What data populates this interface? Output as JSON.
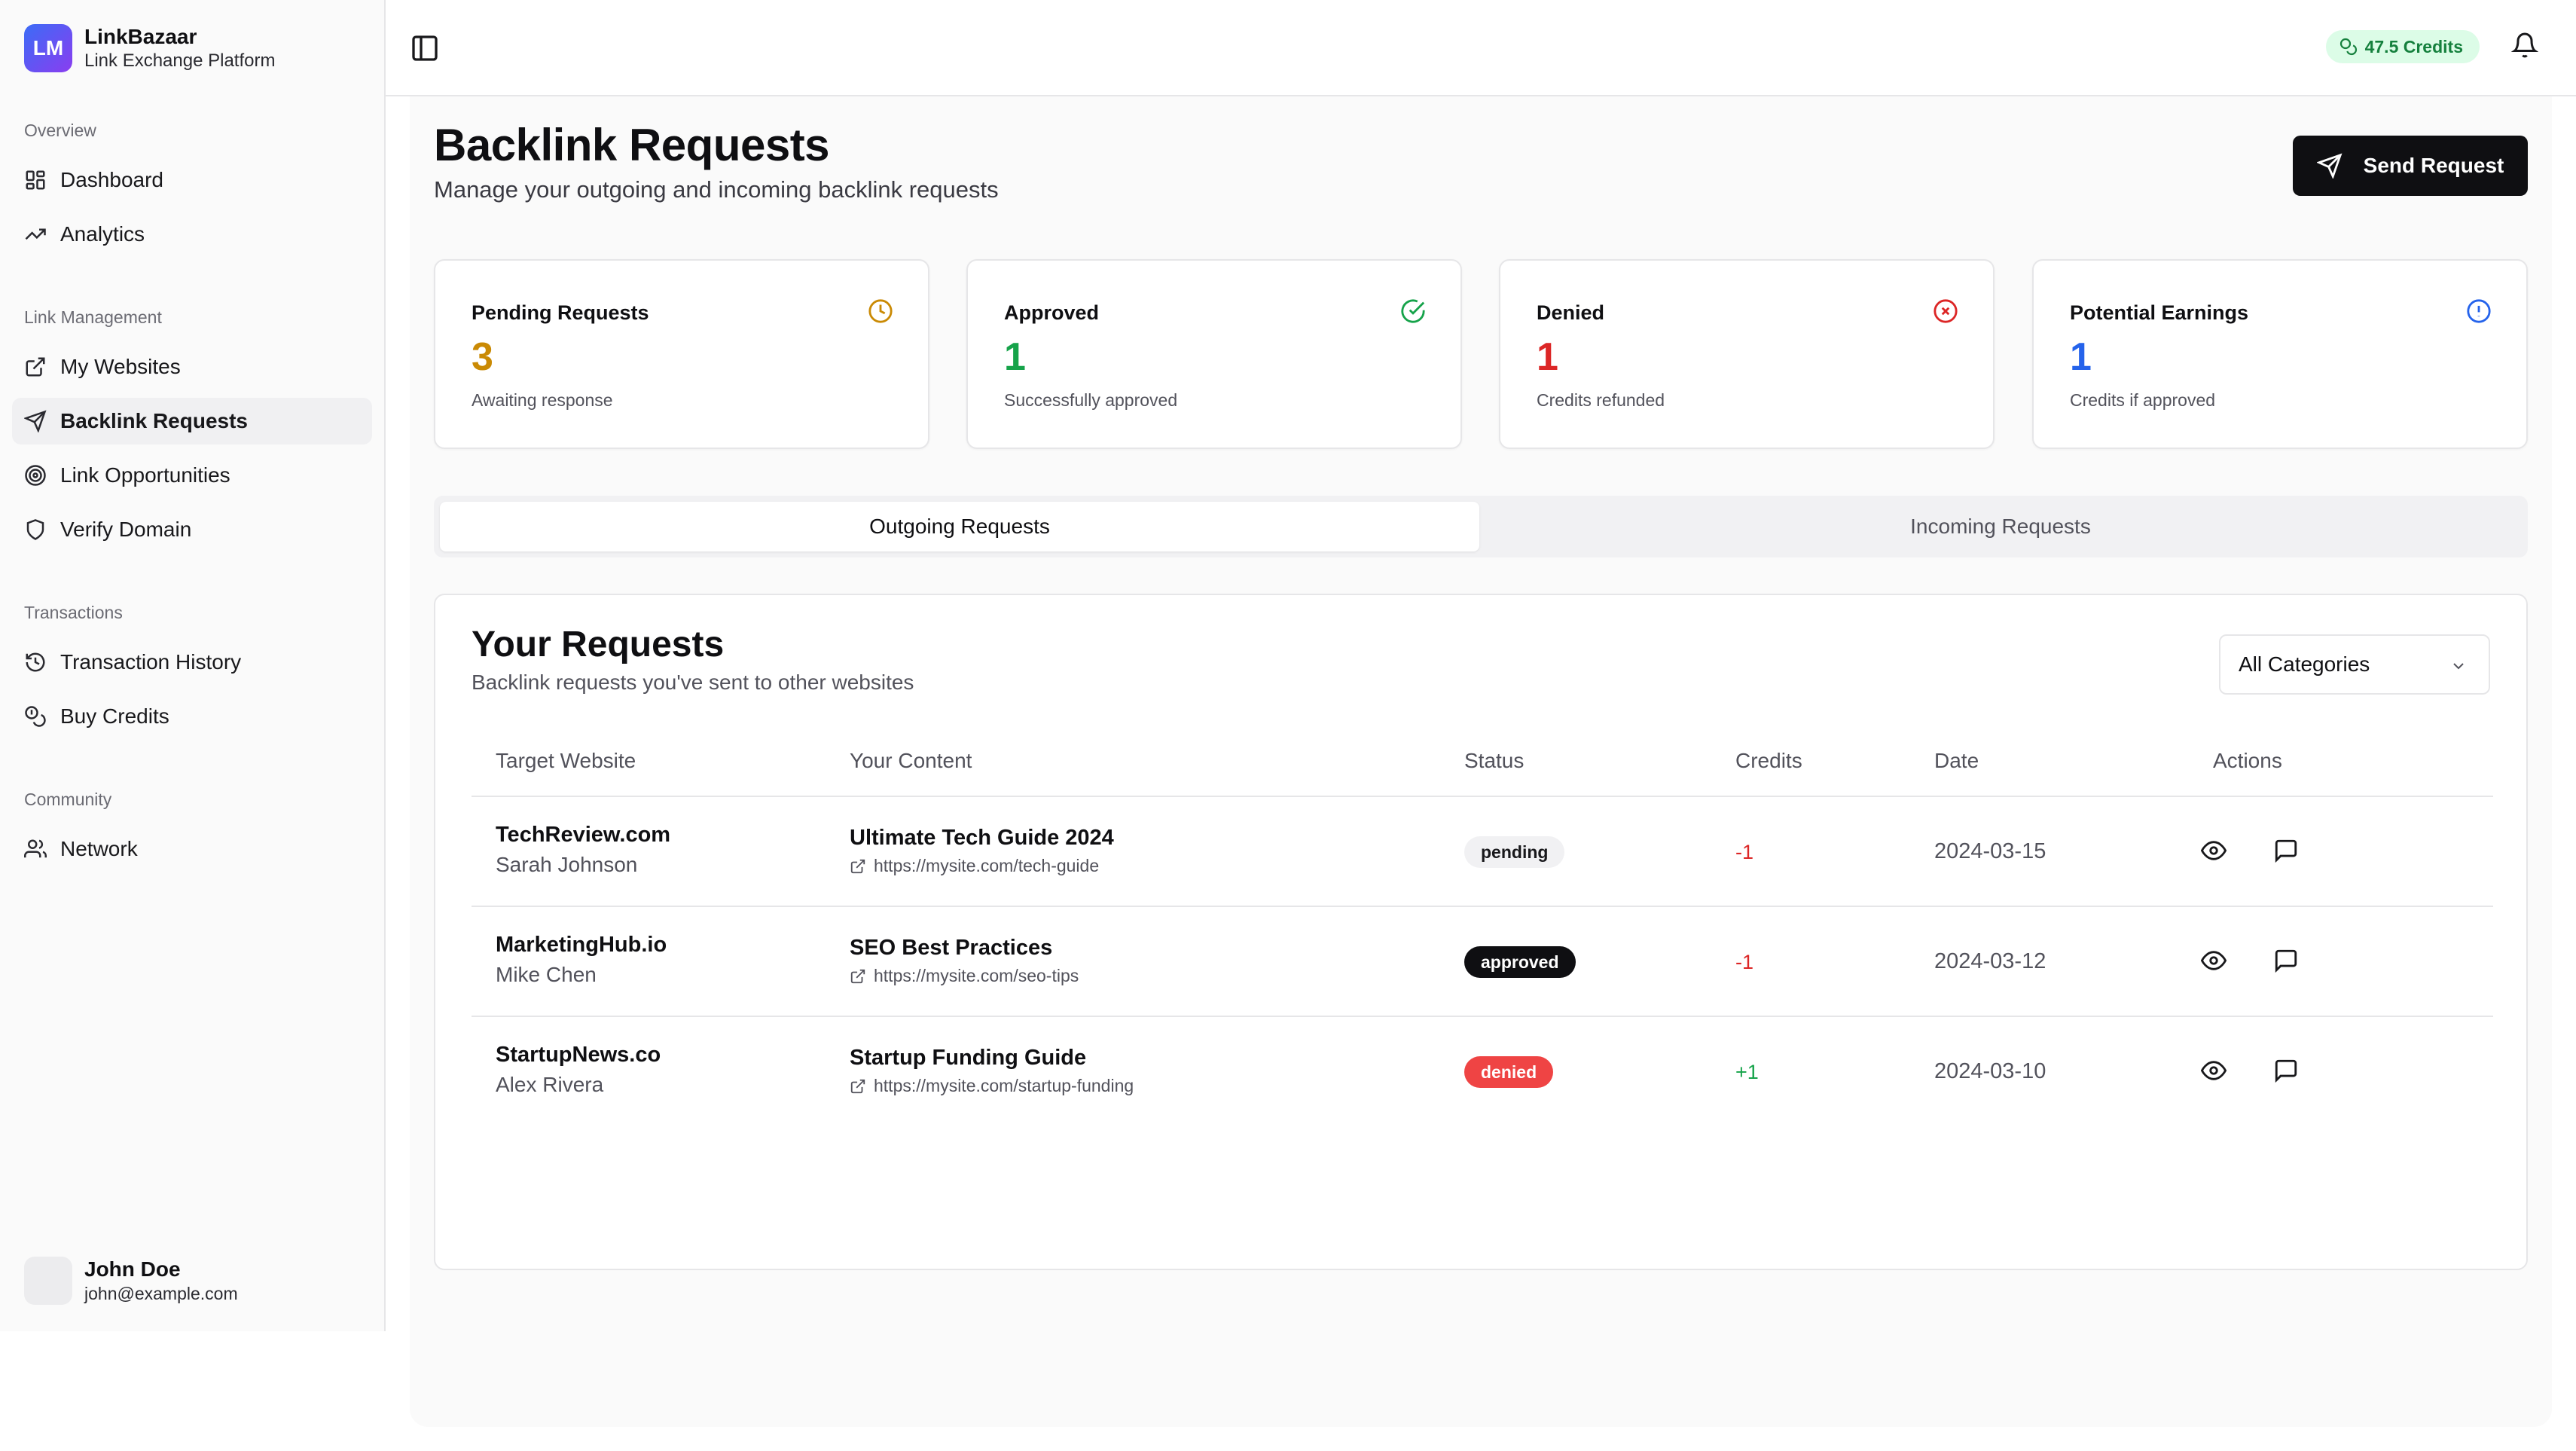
{
  "app": {
    "logo_initials": "LM",
    "name": "LinkBazaar",
    "tagline": "Link Exchange Platform"
  },
  "sidebar": {
    "groups": [
      {
        "label": "Overview",
        "items": [
          {
            "label": "Dashboard",
            "icon": "dashboard-icon"
          },
          {
            "label": "Analytics",
            "icon": "trending-up-icon"
          }
        ]
      },
      {
        "label": "Link Management",
        "items": [
          {
            "label": "My Websites",
            "icon": "external-link-icon"
          },
          {
            "label": "Backlink Requests",
            "icon": "send-icon",
            "active": true
          },
          {
            "label": "Link Opportunities",
            "icon": "target-icon"
          },
          {
            "label": "Verify Domain",
            "icon": "shield-icon"
          }
        ]
      },
      {
        "label": "Transactions",
        "items": [
          {
            "label": "Transaction History",
            "icon": "history-icon"
          },
          {
            "label": "Buy Credits",
            "icon": "coins-icon"
          }
        ]
      },
      {
        "label": "Community",
        "items": [
          {
            "label": "Network",
            "icon": "users-icon"
          }
        ]
      }
    ],
    "user": {
      "name": "John Doe",
      "email": "john@example.com"
    }
  },
  "topbar": {
    "credits": "47.5 Credits"
  },
  "page": {
    "title": "Backlink Requests",
    "subtitle": "Manage your outgoing and incoming backlink requests",
    "send_button": "Send Request"
  },
  "stats": [
    {
      "title": "Pending Requests",
      "value": "3",
      "note": "Awaiting response",
      "color": "#ca8a04",
      "icon": "clock-icon"
    },
    {
      "title": "Approved",
      "value": "1",
      "note": "Successfully approved",
      "color": "#16a34a",
      "icon": "check-circle-icon"
    },
    {
      "title": "Denied",
      "value": "1",
      "note": "Credits refunded",
      "color": "#dc2626",
      "icon": "x-circle-icon"
    },
    {
      "title": "Potential Earnings",
      "value": "1",
      "note": "Credits if approved",
      "color": "#2563eb",
      "icon": "info-circle-icon"
    }
  ],
  "tabs": [
    {
      "label": "Outgoing Requests",
      "active": true
    },
    {
      "label": "Incoming Requests",
      "active": false
    }
  ],
  "requests_panel": {
    "title": "Your Requests",
    "subtitle": "Backlink requests you've sent to other websites",
    "filter": "All Categories",
    "columns": [
      "Target Website",
      "Your Content",
      "Status",
      "Credits",
      "Date",
      "Actions"
    ],
    "rows": [
      {
        "site": "TechReview.com",
        "owner": "Sarah Johnson",
        "content": "Ultimate Tech Guide 2024",
        "url": "https://mysite.com/tech-guide",
        "status": "pending",
        "credits": "-1",
        "date": "2024-03-15"
      },
      {
        "site": "MarketingHub.io",
        "owner": "Mike Chen",
        "content": "SEO Best Practices",
        "url": "https://mysite.com/seo-tips",
        "status": "approved",
        "credits": "-1",
        "date": "2024-03-12"
      },
      {
        "site": "StartupNews.co",
        "owner": "Alex Rivera",
        "content": "Startup Funding Guide",
        "url": "https://mysite.com/startup-funding",
        "status": "denied",
        "credits": "+1",
        "date": "2024-03-10"
      }
    ]
  }
}
